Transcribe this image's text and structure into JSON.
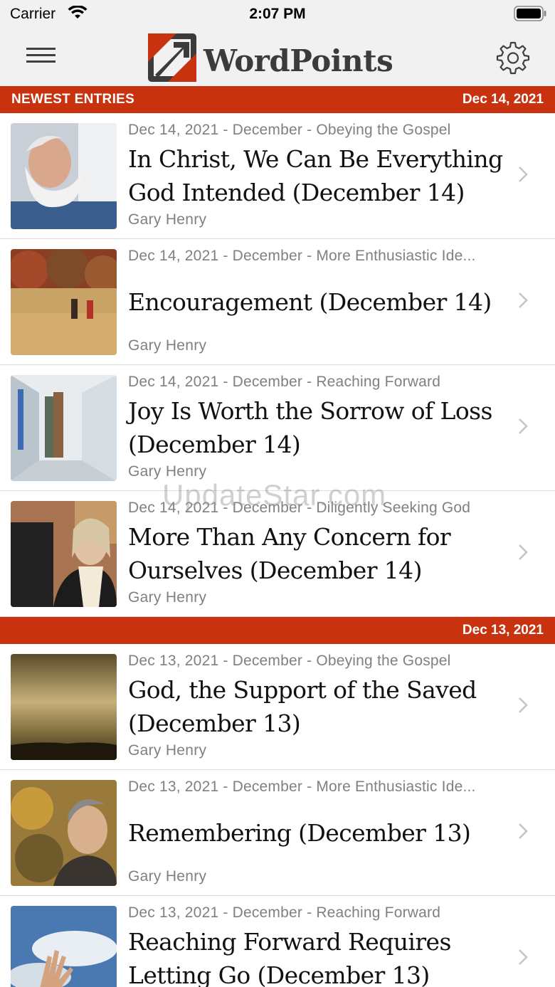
{
  "status_bar": {
    "carrier": "Carrier",
    "time": "2:07 PM"
  },
  "header": {
    "logo_text": "WordPoints",
    "menu_icon": "hamburger-icon",
    "settings_icon": "gear-icon"
  },
  "brand_color": "#c8320f",
  "sections": [
    {
      "label": "NEWEST ENTRIES",
      "date": "Dec 14, 2021",
      "entries": [
        {
          "meta": "Dec 14, 2021 - December - Obeying the Gospel",
          "title": "In Christ, We Can Be Everything God Intended (December 14)",
          "author": "Gary Henry",
          "thumb": "bearded-man-photo"
        },
        {
          "meta": "Dec 14, 2021 - December - More Enthusiastic Ide...",
          "title": "Encouragement (December 14)",
          "author": "Gary Henry",
          "thumb": "field-walkers-photo"
        },
        {
          "meta": "Dec 14, 2021 - December - Reaching Forward",
          "title": "Joy Is Worth the Sorrow of Loss (December 14)",
          "author": "Gary Henry",
          "thumb": "hospital-hallway-photo"
        },
        {
          "meta": "Dec 14, 2021 - December - Diligently Seeking God",
          "title": "More Than Any Concern for Ourselves (December 14)",
          "author": "Gary Henry",
          "thumb": "woman-scarf-photo"
        }
      ]
    },
    {
      "label": "",
      "date": "Dec 13, 2021",
      "entries": [
        {
          "meta": "Dec 13, 2021 - December - Obeying the Gospel",
          "title": "God, the Support of the Saved (December 13)",
          "author": "Gary Henry",
          "thumb": "golden-sky-photo"
        },
        {
          "meta": "Dec 13, 2021 - December - More Enthusiastic Ide...",
          "title": "Remembering (December 13)",
          "author": "Gary Henry",
          "thumb": "man-autumn-photo"
        },
        {
          "meta": "Dec 13, 2021 - December - Reaching Forward",
          "title": "Reaching Forward Requires Letting Go (December 13)",
          "author": "",
          "thumb": "hand-sky-photo"
        }
      ]
    }
  ],
  "watermark": "UpdateStar.com"
}
